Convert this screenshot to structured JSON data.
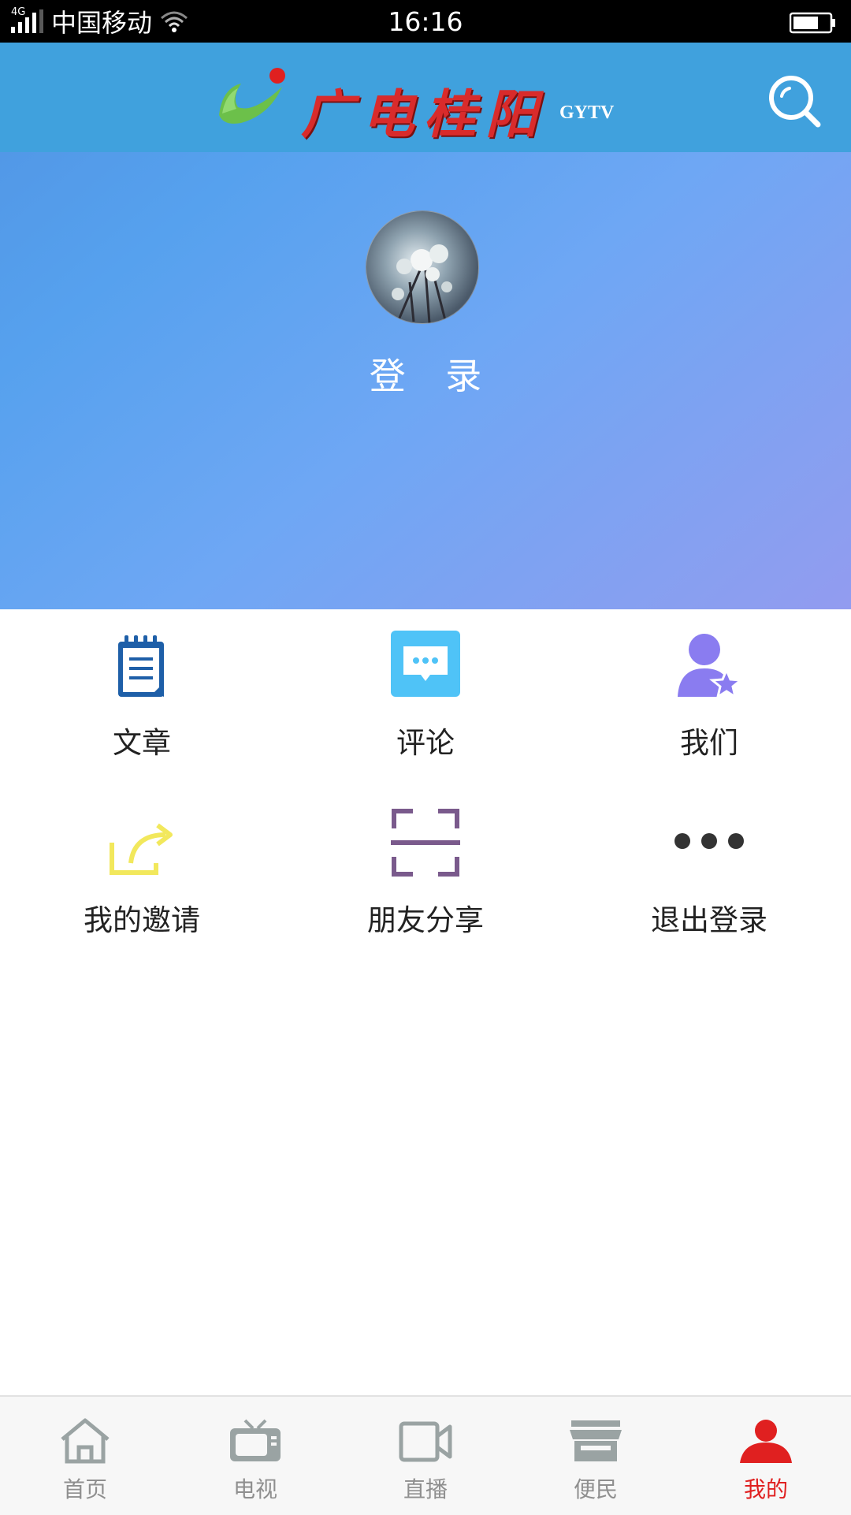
{
  "status_bar": {
    "network_tag": "4G",
    "carrier": "中国移动",
    "time": "16:16",
    "battery_level": 0.7
  },
  "header": {
    "logo_text": "广电桂阳",
    "logo_subtext": "GYTV",
    "search_icon": "search-icon"
  },
  "profile": {
    "login_label": "登 录"
  },
  "menu": [
    {
      "label": "文章",
      "icon": "notepad-icon",
      "color": "#1e5fa8"
    },
    {
      "label": "评论",
      "icon": "chat-bubble-icon",
      "color": "#4fc3f7"
    },
    {
      "label": "我们",
      "icon": "user-star-icon",
      "color": "#8a7cf0"
    },
    {
      "label": "我的邀请",
      "icon": "share-arrow-icon",
      "color": "#f2e85c"
    },
    {
      "label": "朋友分享",
      "icon": "scan-frame-icon",
      "color": "#7a5a8c"
    },
    {
      "label": "退出登录",
      "icon": "more-dots-icon",
      "color": "#333333"
    }
  ],
  "tab_bar": {
    "items": [
      {
        "label": "首页",
        "icon": "home-icon"
      },
      {
        "label": "电视",
        "icon": "tv-icon"
      },
      {
        "label": "直播",
        "icon": "video-camera-icon"
      },
      {
        "label": "便民",
        "icon": "store-icon"
      },
      {
        "label": "我的",
        "icon": "user-icon"
      }
    ],
    "active_index": 4,
    "active_color": "#e02020",
    "inactive_color": "#8f8f8f"
  }
}
